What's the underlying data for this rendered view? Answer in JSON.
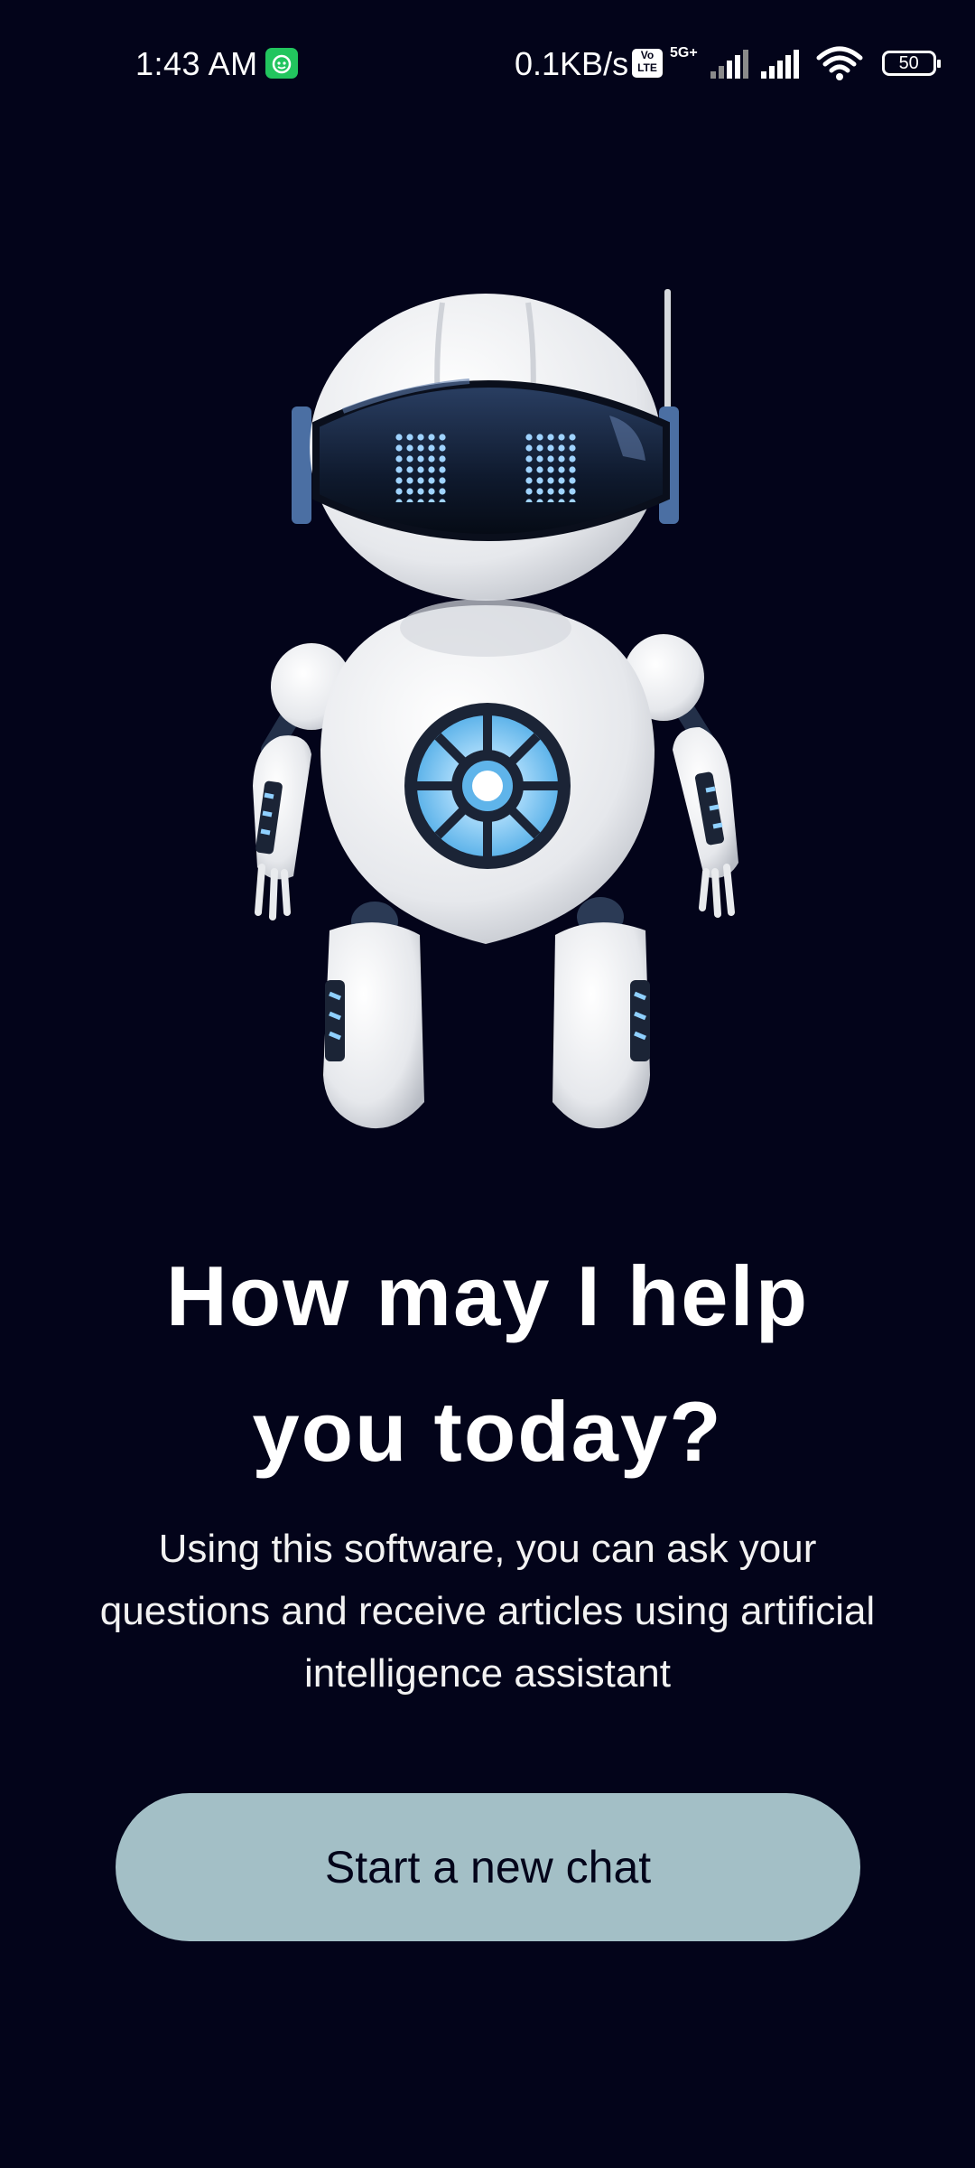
{
  "status_bar": {
    "time": "1:43 AM",
    "net_speed": "0.1KB/s",
    "volte_label": "Vo\nLTE",
    "network_type": "5G+",
    "battery_level": "50",
    "icons": [
      "app-notification-icon",
      "volte-icon",
      "signal-icon",
      "signal-icon",
      "wifi-icon",
      "battery-icon"
    ]
  },
  "hero": {
    "illustration": "robot-illustration",
    "title_line1": "How may I help",
    "title_line2": "you today?",
    "subtitle": "Using this software, you can ask your questions and receive articles using artificial intelligence assistant"
  },
  "actions": {
    "start_chat_label": "Start a new chat"
  },
  "colors": {
    "background": "#03041a",
    "button": "#a3bfc6",
    "button_text": "#03041a"
  }
}
